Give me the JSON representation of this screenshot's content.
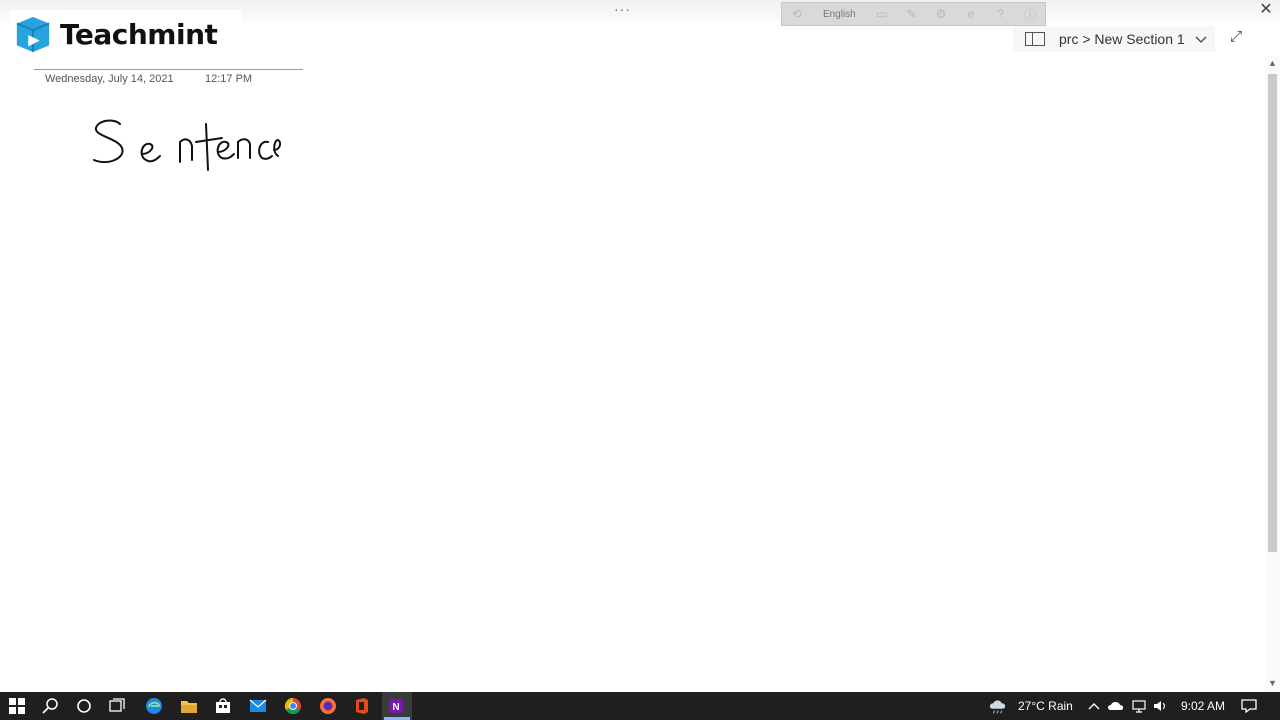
{
  "brand": {
    "name": "Teachmint",
    "accent": "#29a3e0"
  },
  "ime_toolbar": {
    "language": "English",
    "icons": [
      "ime-mode-icon",
      "keyboard-icon",
      "pen-icon",
      "settings-icon",
      "ie-icon",
      "help-icon",
      "info-icon"
    ]
  },
  "breadcrumb": {
    "text": "prc > New Section 1"
  },
  "page": {
    "date": "Wednesday, July 14, 2021",
    "time": "12:17 PM",
    "handwriting": "Sentence"
  },
  "taskbar": {
    "weather": "27°C  Rain",
    "clock": "9:02 AM",
    "apps": [
      "start",
      "search",
      "cortana",
      "task-view",
      "edge",
      "file-explorer",
      "store",
      "mail",
      "chrome",
      "firefox",
      "office",
      "onenote"
    ]
  }
}
